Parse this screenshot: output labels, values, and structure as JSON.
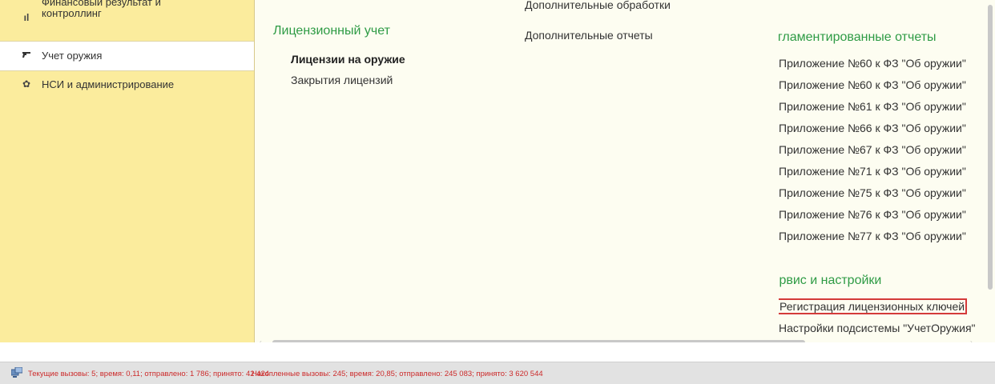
{
  "sidebar": {
    "items": [
      {
        "label_line1": "Финансовый результат и",
        "label_line2": "контроллинг",
        "icon": "bar-chart-icon"
      },
      {
        "label": "Учет оружия",
        "icon": "pistol-icon"
      },
      {
        "label": "НСИ и администрирование",
        "icon": "gear-icon"
      }
    ]
  },
  "column1": {
    "title": "Лицензионный учет",
    "links": [
      "Лицензии на оружие",
      "Закрытия лицензий"
    ]
  },
  "column2": {
    "links": [
      "Дополнительные обработки",
      "Дополнительные отчеты"
    ]
  },
  "column3": {
    "title_reports": "Регламентированные отчеты",
    "reports": [
      "Приложение №60 к ФЗ \"Об оружии\"",
      "Приложение №60 к ФЗ \"Об оружии\"",
      "Приложение №61 к ФЗ \"Об оружии\"",
      "Приложение №66 к ФЗ \"Об оружии\"",
      "Приложение №67 к ФЗ \"Об оружии\"",
      "Приложение №71 к ФЗ \"Об оружии\"",
      "Приложение №75 к ФЗ \"Об оружии\"",
      "Приложение №76 к ФЗ \"Об оружии\"",
      "Приложение №77 к ФЗ \"Об оружии\""
    ],
    "title_service": "Сервис и настройки",
    "service_links": [
      "Регистрация лицензионных ключей",
      "Настройки подсистемы \"УчетОружия\""
    ]
  },
  "status": {
    "current": "Текущие вызовы: 5; время: 0,11; отправлено: 1 786; принято: 42 424",
    "accumulated": "Накопленные вызовы: 245; время: 20,85; отправлено: 245 083; принято: 3 620 544"
  }
}
